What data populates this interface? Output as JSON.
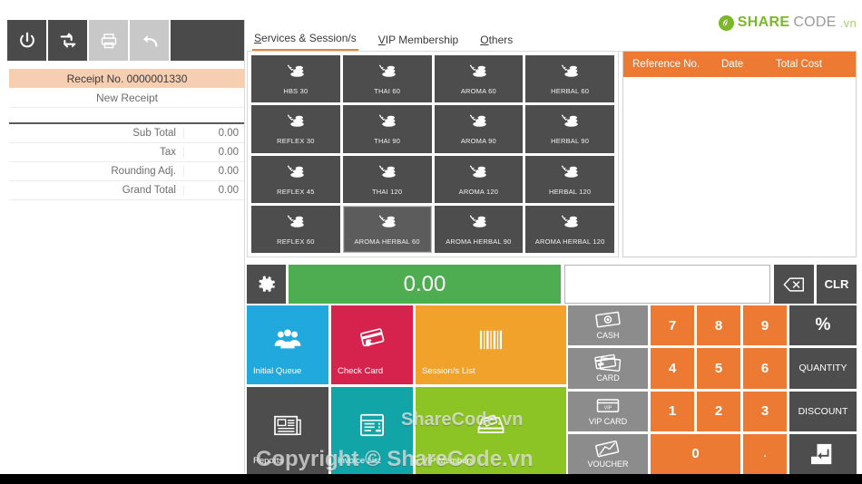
{
  "logo": {
    "mark": "leaf-circle-icon",
    "share": "SHARE",
    "code": "CODE",
    "vn": ".vn"
  },
  "toolbar": {
    "buttons": [
      {
        "name": "power-button",
        "icon": "power-icon",
        "state": "enabled"
      },
      {
        "name": "refresh-button",
        "icon": "refresh-icon",
        "state": "enabled"
      },
      {
        "name": "print-button",
        "icon": "printer-icon",
        "state": "disabled"
      },
      {
        "name": "undo-button",
        "icon": "undo-icon",
        "state": "disabled"
      }
    ]
  },
  "receipt": {
    "number_label": "Receipt No. 0000001330",
    "status_label": "New Receipt",
    "totals": [
      {
        "label": "Sub Total",
        "value": "0.00"
      },
      {
        "label": "Tax",
        "value": "0.00"
      },
      {
        "label": "Rounding Adj.",
        "value": "0.00"
      },
      {
        "label": "Grand Total",
        "value": "0.00"
      }
    ]
  },
  "tabs": [
    {
      "accel": "S",
      "rest": "ervices & Session/s",
      "active": true
    },
    {
      "accel": "V",
      "rest": "IP Membership",
      "active": false
    },
    {
      "accel": "O",
      "rest": "thers",
      "active": false
    }
  ],
  "services": [
    {
      "label": "HBS 30",
      "icon": "spa-stones-icon",
      "hover": false
    },
    {
      "label": "THAI 60",
      "icon": "spa-stones-icon",
      "hover": false
    },
    {
      "label": "AROMA 60",
      "icon": "spa-stones-icon",
      "hover": false
    },
    {
      "label": "HERBAL 60",
      "icon": "spa-stones-icon",
      "hover": false
    },
    {
      "label": "REFLEX 30",
      "icon": "spa-stones-icon",
      "hover": false
    },
    {
      "label": "THAI 90",
      "icon": "spa-stones-icon",
      "hover": false
    },
    {
      "label": "AROMA 90",
      "icon": "spa-stones-icon",
      "hover": false
    },
    {
      "label": "HERBAL 90",
      "icon": "spa-stones-icon",
      "hover": false
    },
    {
      "label": "REFLEX 45",
      "icon": "spa-stones-icon",
      "hover": false
    },
    {
      "label": "THAI 120",
      "icon": "spa-stones-icon",
      "hover": false
    },
    {
      "label": "AROMA 120",
      "icon": "spa-stones-icon",
      "hover": false
    },
    {
      "label": "HERBAL 120",
      "icon": "spa-stones-icon",
      "hover": false
    },
    {
      "label": "REFLEX 60",
      "icon": "spa-stones-icon",
      "hover": false
    },
    {
      "label": "AROMA HERBAL 60",
      "icon": "spa-stones-icon",
      "hover": true
    },
    {
      "label": "AROMA HERBAL 90",
      "icon": "spa-stones-icon",
      "hover": false
    },
    {
      "label": "AROMA HERBAL 120",
      "icon": "spa-stones-icon",
      "hover": false
    }
  ],
  "reference_list": {
    "columns": [
      "Reference No.",
      "Date",
      "Total Cost"
    ],
    "rows": []
  },
  "display": {
    "gear_icon": "gear-icon",
    "amount": "0.00",
    "input_value": "",
    "backspace_icon": "backspace-icon",
    "clear_label": "CLR"
  },
  "tiles": [
    {
      "label": "Initial Queue",
      "icon": "people-group-icon",
      "color": "#21a8dc"
    },
    {
      "label": "Check Card",
      "icon": "card-swipe-icon",
      "color": "#d6234d"
    },
    {
      "label": "Session/s List",
      "icon": "barcode-icon",
      "color": "#f0a22a"
    },
    {
      "label": "Reports",
      "icon": "newspaper-icon",
      "color": "#4d4d4d"
    },
    {
      "label": "Invoice List",
      "icon": "invoice-icon",
      "color": "#12a5a8"
    },
    {
      "label": "VIP Members",
      "icon": "card-tray-icon",
      "color": "#8cc425"
    }
  ],
  "payment_buttons": [
    {
      "label": "CASH",
      "icon": "cash-icon"
    },
    {
      "label": "CARD",
      "icon": "credit-cards-icon"
    },
    {
      "label": "VIP CARD",
      "icon": "vip-card-icon"
    },
    {
      "label": "VOUCHER",
      "icon": "voucher-icon"
    }
  ],
  "keypad": {
    "keys": [
      "7",
      "8",
      "9",
      "4",
      "5",
      "6",
      "1",
      "2",
      "3"
    ],
    "zero": "0",
    "decimal": "."
  },
  "function_buttons": [
    {
      "label": "%",
      "name": "percent-button"
    },
    {
      "label": "QUANTITY",
      "name": "quantity-button"
    },
    {
      "label": "DISCOUNT",
      "name": "discount-button"
    },
    {
      "label": "",
      "name": "enter-button",
      "icon": "enter-icon"
    }
  ],
  "watermarks": {
    "primary": "ShareCode.vn",
    "copyright": "Copyright © ShareCode.vn"
  }
}
